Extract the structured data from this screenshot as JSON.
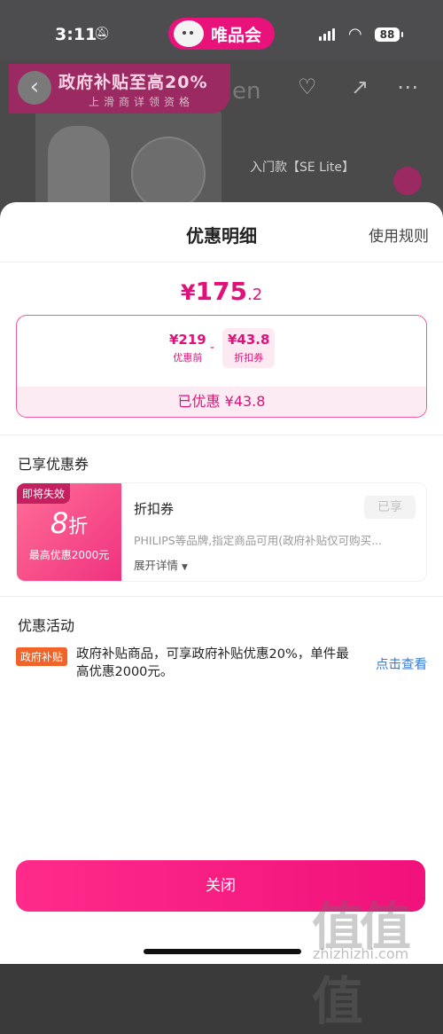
{
  "status_bar": {
    "time": "3:11",
    "app_name": "唯品会",
    "battery": "88"
  },
  "background": {
    "banner_title": "政府补贴至高20%",
    "banner_subtitle": "上滑商详领资格",
    "brand_fragment": "en",
    "model_text": "入门款【SE Lite】"
  },
  "sheet": {
    "title": "优惠明细",
    "rules_link": "使用规则",
    "final_price": {
      "currency": "¥",
      "integer": "175",
      "decimal": ".2"
    },
    "calc": {
      "original_value": "¥219",
      "original_label": "优惠前",
      "minus": "-",
      "discount_value": "¥43.8",
      "discount_label": "折扣券",
      "saved_text": "已优惠 ¥43.8"
    },
    "coupons_section_title": "已享优惠券",
    "coupon": {
      "expire_badge": "即将失效",
      "discount_number": "8",
      "discount_unit": "折",
      "max_discount": "最高优惠2000元",
      "name": "折扣券",
      "description": "PHILIPS等品牌,指定商品可用(政府补贴仅可购买...",
      "expand_label": "展开详情",
      "status": "已享"
    },
    "activity_section_title": "优惠活动",
    "activity": {
      "tag": "政府补贴",
      "description": "政府补贴商品，可享政府补贴优惠20%，单件最高优惠2000元。",
      "link": "点击查看"
    },
    "close_button": "关闭"
  },
  "watermark": {
    "text": "值值值",
    "url": "zhizhizhi.com"
  },
  "colors": {
    "accent": "#e0117a",
    "link": "#3a7ad9",
    "activity_tag": "#f0642a"
  }
}
